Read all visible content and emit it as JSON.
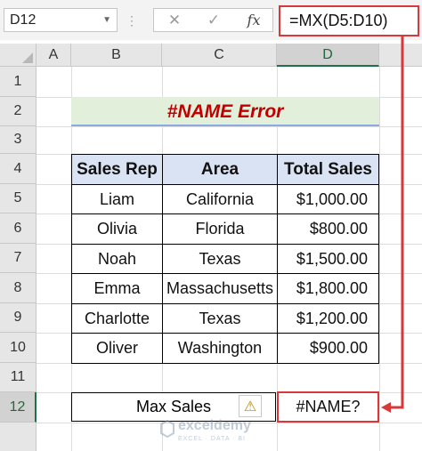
{
  "formula_bar": {
    "name_box": "D12",
    "cancel_icon": "✕",
    "enter_icon": "✓",
    "fx_label": "fx",
    "formula": "=MX(D5:D10)"
  },
  "columns": [
    "A",
    "B",
    "C",
    "D"
  ],
  "rows": [
    "1",
    "2",
    "3",
    "4",
    "5",
    "6",
    "7",
    "8",
    "9",
    "10",
    "11",
    "12"
  ],
  "title": "#NAME  Error",
  "table": {
    "headers": [
      "Sales Rep",
      "Area",
      "Total Sales"
    ],
    "rows": [
      [
        "Liam",
        "California",
        "$1,000.00"
      ],
      [
        "Olivia",
        "Florida",
        "$800.00"
      ],
      [
        "Noah",
        "Texas",
        "$1,500.00"
      ],
      [
        "Emma",
        "Massachusetts",
        "$1,800.00"
      ],
      [
        "Charlotte",
        "Texas",
        "$1,200.00"
      ],
      [
        "Oliver",
        "Washington",
        "$900.00"
      ]
    ]
  },
  "max_sales": {
    "label": "Max Sales",
    "value": "#NAME?",
    "warning_icon": "⚠"
  },
  "watermark": {
    "name": "exceldemy",
    "tagline": "EXCEL · DATA · BI"
  },
  "colors": {
    "error_red": "#d9383a",
    "title_bg": "#e2efda",
    "header_bg": "#dae3f3",
    "selected_green": "#1e7145"
  }
}
